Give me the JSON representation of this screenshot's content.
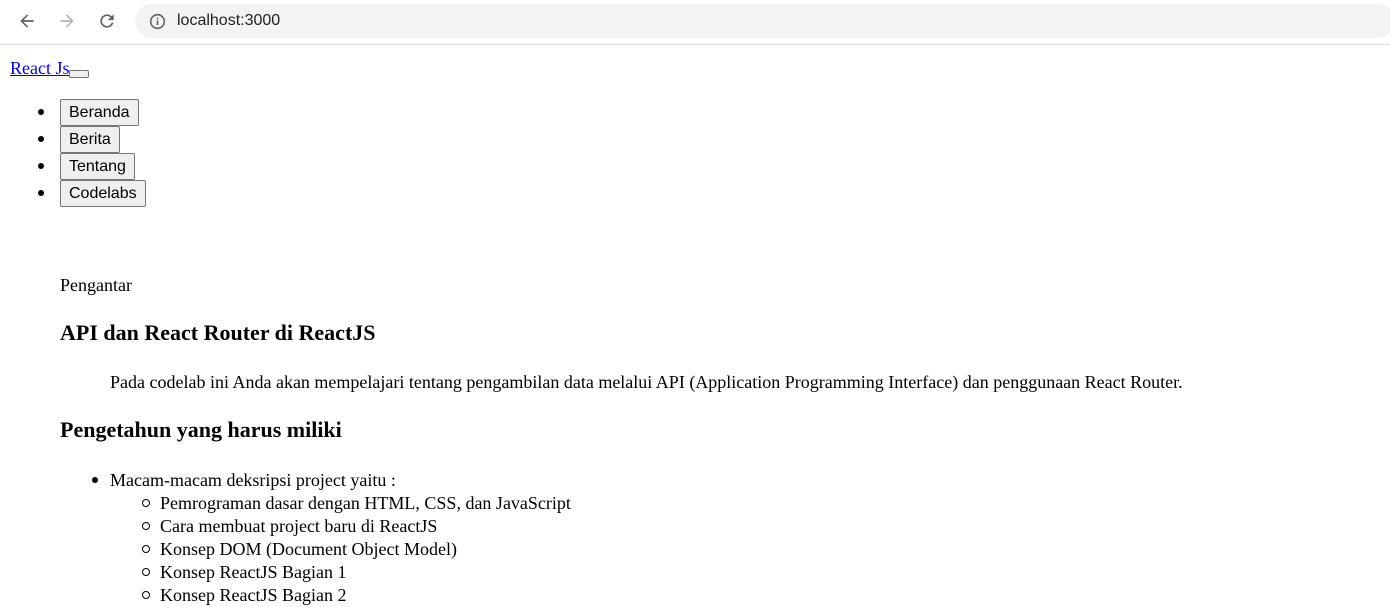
{
  "browser": {
    "url": "localhost:3000",
    "icons": {
      "back": "arrow-left-icon",
      "forward": "arrow-right-icon",
      "reload": "reload-icon",
      "site_info": "info-icon"
    }
  },
  "navbar": {
    "brand": "React Js",
    "menu": [
      "Beranda",
      "Berita",
      "Tentang",
      "Codelabs"
    ]
  },
  "content": {
    "eyebrow": "Pengantar",
    "title": "API dan React Router di ReactJS",
    "description": "Pada codelab ini Anda akan mempelajari tentang pengambilan data melalui API (Application Programming Interface) dan penggunaan React Router.",
    "section_title": "Pengetahun yang harus miliki",
    "list_intro": "Macam-macam deksripsi project yaitu :",
    "items": [
      "Pemrograman dasar dengan HTML, CSS, dan JavaScript",
      "Cara membuat project baru di ReactJS",
      "Konsep DOM (Document Object Model)",
      "Konsep ReactJS Bagian 1",
      "Konsep ReactJS Bagian 2"
    ]
  }
}
